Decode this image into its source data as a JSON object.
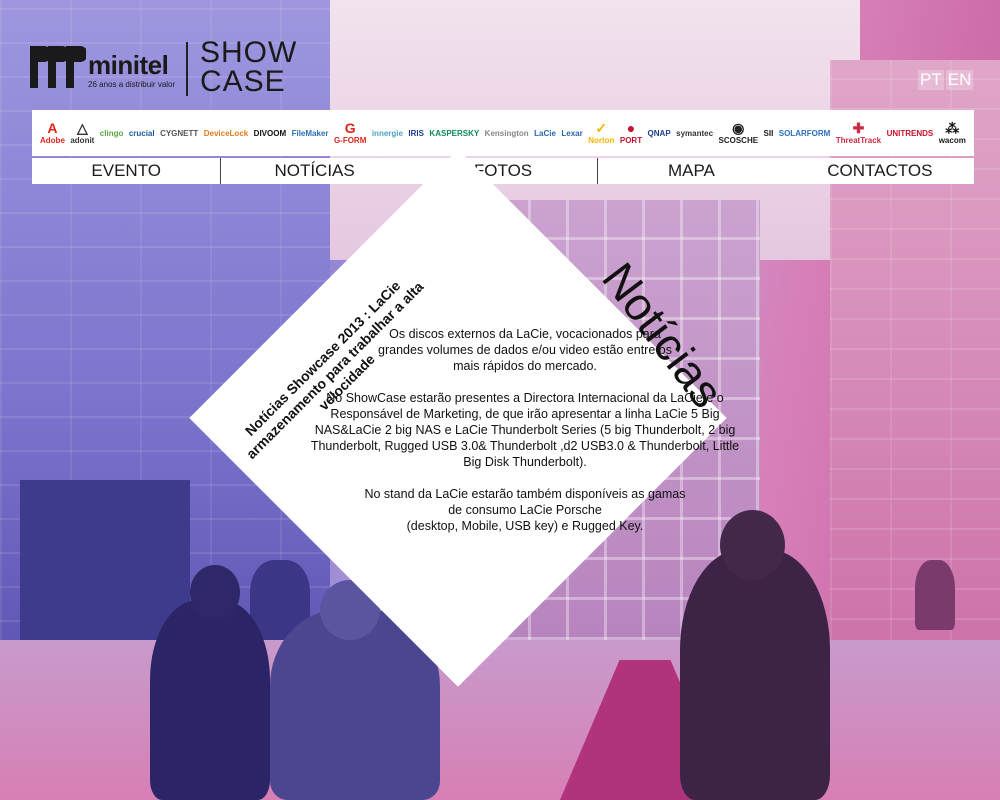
{
  "header": {
    "brand_name": "minitel",
    "brand_tagline": "26 anos a distribuir valor",
    "event_line1": "SHOW",
    "event_line2": "CASE"
  },
  "languages": [
    {
      "label": "PT"
    },
    {
      "label": "EN"
    }
  ],
  "brands": [
    {
      "name": "Adobe",
      "glyph": "A",
      "color": "#e1251b"
    },
    {
      "name": "adonit",
      "glyph": "△",
      "color": "#333333"
    },
    {
      "name": "clingo",
      "glyph": "",
      "color": "#58a83d"
    },
    {
      "name": "crucial",
      "glyph": "",
      "color": "#1d5aa3"
    },
    {
      "name": "CYGNETT",
      "glyph": "",
      "color": "#555555"
    },
    {
      "name": "DeviceLock",
      "glyph": "",
      "color": "#e57a1e"
    },
    {
      "name": "DIVOOM",
      "glyph": "",
      "color": "#111111"
    },
    {
      "name": "FileMaker",
      "glyph": "",
      "color": "#2a6fb8"
    },
    {
      "name": "G-FORM",
      "glyph": "G",
      "color": "#d9261c"
    },
    {
      "name": "innergie",
      "glyph": "",
      "color": "#4aa3c7"
    },
    {
      "name": "IRIS",
      "glyph": "",
      "color": "#1e3f8f"
    },
    {
      "name": "KASPERSKY",
      "glyph": "",
      "color": "#0c8a5a"
    },
    {
      "name": "Kensington",
      "glyph": "",
      "color": "#888888"
    },
    {
      "name": "LaCie",
      "glyph": "",
      "color": "#2b66b1"
    },
    {
      "name": "Lexar",
      "glyph": "",
      "color": "#2b66b1"
    },
    {
      "name": "Norton",
      "glyph": "✓",
      "color": "#f2b600"
    },
    {
      "name": "PORT",
      "glyph": "●",
      "color": "#c8102e"
    },
    {
      "name": "QNAP",
      "glyph": "",
      "color": "#1a3e8c"
    },
    {
      "name": "symantec",
      "glyph": "",
      "color": "#333333"
    },
    {
      "name": "SCOSCHE",
      "glyph": "◉",
      "color": "#222222"
    },
    {
      "name": "SII",
      "glyph": "",
      "color": "#1a1a1a"
    },
    {
      "name": "SOLARFORM",
      "glyph": "",
      "color": "#2a6fb8"
    },
    {
      "name": "ThreatTrack",
      "glyph": "✚",
      "color": "#cc2b47"
    },
    {
      "name": "UNITRENDS",
      "glyph": "",
      "color": "#c8102e"
    },
    {
      "name": "wacom",
      "glyph": "⁂",
      "color": "#1a1a1a"
    }
  ],
  "nav": [
    {
      "label": "EVENTO"
    },
    {
      "label": "NOTÍCIAS"
    },
    {
      "label": "FOTOS"
    },
    {
      "label": "MAPA"
    },
    {
      "label": "CONTACTOS"
    }
  ],
  "article": {
    "title": "Notícias",
    "side_caption": "Notícias Showcase 2013 : LaCie armazenamento para trabalhar a alta velocidade",
    "paragraph1": "Os discos externos da LaCie, vocacionados para grandes volumes de dados e/ou video estão entre os mais rápidos do mercado.",
    "paragraph2": "No ShowCase estarão presentes a Directora Internacional da LaCie e o Responsável de Marketing, de que irão apresentar a linha LaCie 5 Big NAS&LaCie 2 big NAS e LaCie Thunderbolt Series (5 big Thunderbolt, 2 big Thunderbolt, Rugged USB 3.0& Thunderbolt ,d2 USB3.0 & Thunderbolt, Little Big Disk Thunderbolt).",
    "paragraph3_line1": "No stand da LaCie estarão também disponíveis as gamas",
    "paragraph3_line2": "de consumo LaCie Porsche",
    "paragraph3_line3": "(desktop, Mobile, USB key) e Rugged Key."
  }
}
